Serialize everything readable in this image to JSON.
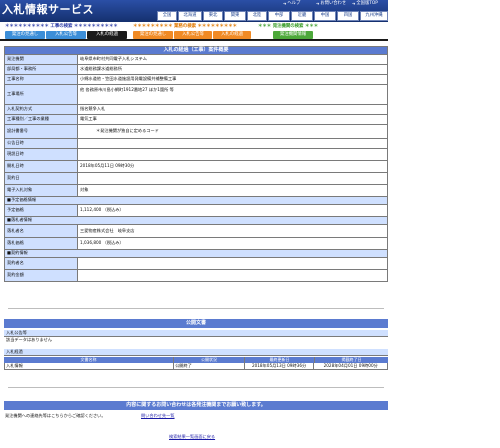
{
  "header": {
    "title": "入札情報サービス",
    "links": [
      "ヘルプ",
      "お問い合わせ",
      "全国版TOP"
    ],
    "regions": [
      "全国",
      "北海道",
      "東北",
      "関東",
      "北陸",
      "中部",
      "近畿",
      "中国",
      "四国",
      "九州沖縄"
    ]
  },
  "categories": [
    {
      "label": "＊＊＊＊＊＊＊＊＊＊ 工事の検索 ＊＊＊＊＊＊＊＊＊＊",
      "color": "#2f3fa8"
    },
    {
      "label": "＊＊＊＊＊＊＊＊＊ 業務の検索 ＊＊＊＊＊＊＊＊＊",
      "color": "#e07800"
    },
    {
      "label": "＊＊＊ 発注機関の検索 ＊＊＊",
      "color": "#3a9c2a"
    }
  ],
  "tabs": [
    {
      "label": "発注の見通し",
      "color": "#3c8ed8"
    },
    {
      "label": "入札公告等",
      "color": "#3c8ed8"
    },
    {
      "label": "入札の経過",
      "color": "#1a1a1a"
    },
    {
      "label": "発注の見通し",
      "color": "#f08a24"
    },
    {
      "label": "入札公告等",
      "color": "#f08a24"
    },
    {
      "label": "入札の経過",
      "color": "#f08a24"
    },
    {
      "label": "発注機関情報",
      "color": "#4da83a"
    }
  ],
  "detail": {
    "title": "入札の経過（工事）案件概要",
    "rows": [
      {
        "label": "発注機関",
        "value": "岐阜県市町村共同電子入札システム"
      },
      {
        "label": "部局都・事務所",
        "value": "水道総務課水道総務所"
      },
      {
        "label": "工事名称",
        "value": "小綿水道他・笠田水道施設用発電設備共補整備工事"
      },
      {
        "label": "工事場所",
        "value": "他 各務原市川島小網町1912番地27 ほか1箇所 等"
      },
      {
        "label": "入札契約方式",
        "value": "指名競争入札"
      },
      {
        "label": "工事種別／工事の業種",
        "value": "電気工事"
      },
      {
        "label": "設計書番号",
        "value": "＊発注機関が独自に定めるコード"
      },
      {
        "label": "公告日時",
        "value": ""
      },
      {
        "label": "現説日時",
        "value": ""
      },
      {
        "label": "開札日時",
        "value": "2018年05月11日 09時30分"
      },
      {
        "label": "契約日",
        "value": ""
      },
      {
        "label": "電子入札対象",
        "value": "対象"
      }
    ],
    "price_section": "■予定価格情報",
    "price_rows": [
      {
        "label": "予定価格",
        "value": "1,112,400 （税込み）"
      }
    ],
    "winner_section": "■落札者情報",
    "winner_rows": [
      {
        "label": "落札者名",
        "value": "三愛物産株式会社　岐阜支店"
      },
      {
        "label": "落札価格",
        "value": "1,036,800 （税込み）"
      }
    ],
    "contract_section": "■契約情報",
    "contract_rows": [
      {
        "label": "契約者名",
        "value": ""
      },
      {
        "label": "契約金額",
        "value": ""
      }
    ]
  },
  "documents": {
    "title": "公開文書",
    "notice_label": "入札公告等",
    "notice_empty": "該当データはありません",
    "result_label": "入札経過",
    "columns": [
      "文書名称",
      "公開状況",
      "最終更新日",
      "掲載終了日"
    ],
    "rows": [
      {
        "name": "入札情報",
        "status": "公開終了",
        "updated": "2018年05月13日 09時36分",
        "end": "2028年04月01日 09時00分"
      }
    ]
  },
  "footer": {
    "banner": "内容に関するお問い合わせは各発注機関までお願い致します。",
    "contact_text": "発注機関への連絡先等はこちらからご確認ください。",
    "contact_link": "問い合わせ先一覧",
    "back_link": "検索結果一覧画面に戻る"
  }
}
